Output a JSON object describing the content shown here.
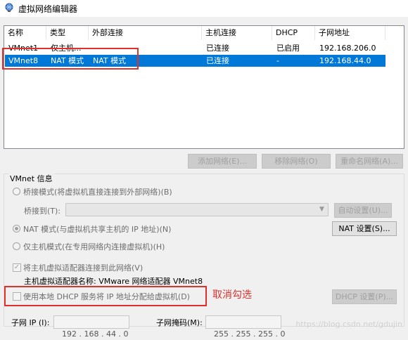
{
  "window": {
    "title": "虚拟网络编辑器"
  },
  "table": {
    "headers": [
      "名称",
      "类型",
      "外部连接",
      "主机连接",
      "DHCP",
      "子网地址"
    ],
    "rows": [
      [
        "VMnet1",
        "仅主机...",
        "-",
        "已连接",
        "已启用",
        "192.168.206.0"
      ],
      [
        "VMnet8",
        "NAT 模式",
        "NAT 模式",
        "已连接",
        "-",
        "192.168.44.0"
      ]
    ],
    "selected_row": 1
  },
  "buttons": {
    "add_network": "添加网络(E)...",
    "remove_network": "移除网络(O)",
    "rename_network": "重命名网络(A)...",
    "auto_settings": "自动设置(U)...",
    "nat_settings": "NAT 设置(S)...",
    "dhcp_settings": "DHCP 设置(P)..."
  },
  "vmnet_info": {
    "group_label": "VMnet 信息",
    "bridge_mode": "桥接模式(将虚拟机直接连接到外部网络)(B)",
    "bridge_to_label": "桥接到(T):",
    "bridge_to_value": "",
    "nat_mode": "NAT 模式(与虚拟机共享主机的 IP 地址)(N)",
    "host_only_mode": "仅主机模式(在专用网络内连接虚拟机)(H)",
    "connect_adapter": "将主机虚拟适配器连接到此网络(V)",
    "adapter_name": "主机虚拟适配器名称: VMware 网络适配器 VMnet8",
    "use_dhcp": "使用本地 DHCP 服务将 IP 地址分配给虚拟机(D)",
    "subnet_ip_label": "子网 IP (I):",
    "subnet_ip": [
      "192",
      "168",
      "44",
      "0"
    ],
    "subnet_mask_label": "子网掩码(M):",
    "subnet_mask": [
      "255",
      "255",
      "255",
      "0"
    ],
    "selected_mode": "nat",
    "connect_adapter_checked": true,
    "use_dhcp_checked": false
  },
  "annotation": {
    "text": "取消勾选",
    "color": "#e0302c"
  },
  "watermark": "https://blog.csdn.net/gdujin",
  "colors": {
    "selection": "#0078d7",
    "highlight_box": "#e0302c"
  }
}
